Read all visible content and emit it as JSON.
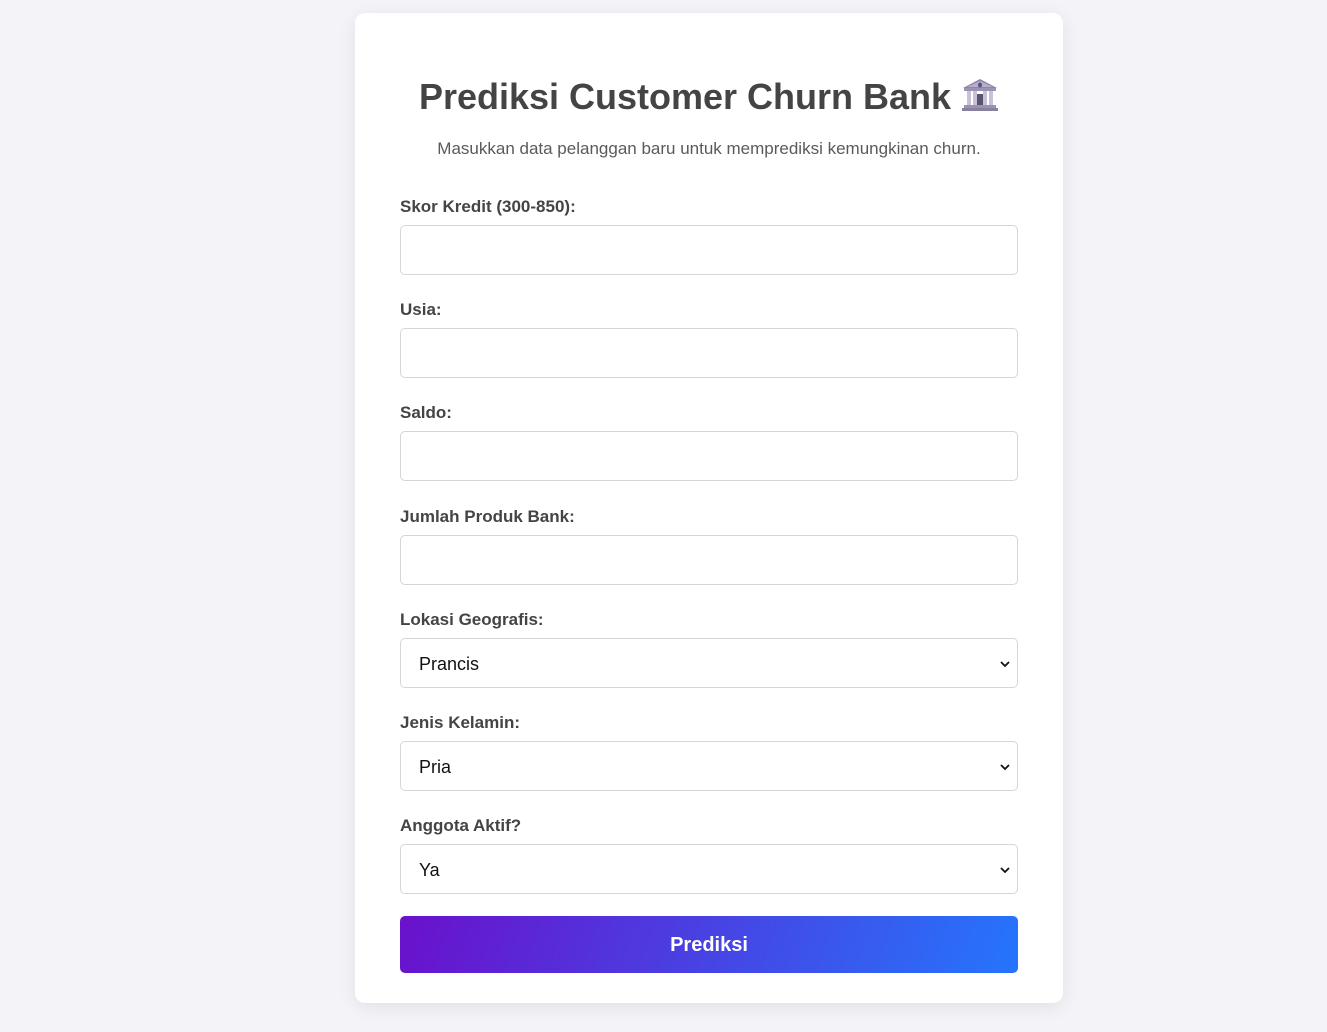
{
  "page": {
    "title": "Prediksi Customer Churn Bank",
    "title_icon": "bank-building-icon",
    "subtitle": "Masukkan data pelanggan baru untuk memprediksi kemungkinan churn."
  },
  "form": {
    "credit_score": {
      "label": "Skor Kredit (300-850):",
      "value": ""
    },
    "age": {
      "label": "Usia:",
      "value": ""
    },
    "balance": {
      "label": "Saldo:",
      "value": ""
    },
    "num_products": {
      "label": "Jumlah Produk Bank:",
      "value": ""
    },
    "geography": {
      "label": "Lokasi Geografis:",
      "selected": "Prancis"
    },
    "gender": {
      "label": "Jenis Kelamin:",
      "selected": "Pria"
    },
    "active_member": {
      "label": "Anggota Aktif?",
      "selected": "Ya"
    },
    "submit_label": "Prediksi"
  },
  "colors": {
    "background": "#f3f3f8",
    "card": "#ffffff",
    "text": "#444444",
    "button_gradient_start": "#6a11cb",
    "button_gradient_end": "#2575fc"
  }
}
